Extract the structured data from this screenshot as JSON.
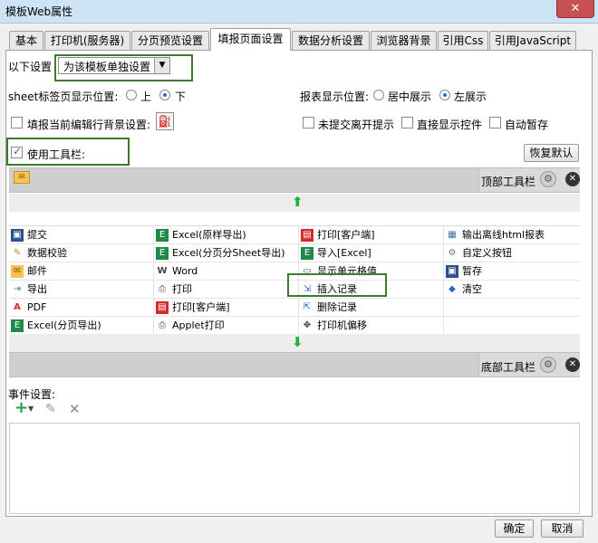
{
  "window": {
    "title": "模板Web属性",
    "close": "✕"
  },
  "tabs": [
    "基本",
    "打印机(服务器)",
    "分页预览设置",
    "填报页面设置",
    "数据分析设置",
    "浏览器背景",
    "引用Css",
    "引用JavaScript"
  ],
  "settings": {
    "below_label": "以下设置",
    "scope_value": "为该模板单独设置",
    "sheet_label": "sheet标签页显示位置:",
    "sheet_opt_top": "上",
    "sheet_opt_bottom": "下",
    "report_label": "报表显示位置:",
    "report_opt_center": "居中展示",
    "report_opt_left": "左展示",
    "fill_bg_label": "填报当前编辑行背景设置:",
    "unsubmitted_label": "未提交离开提示",
    "direct_show_label": "直接显示控件",
    "autosave_label": "自动暂存",
    "use_toolbar_label": "使用工具栏:",
    "restore_default": "恢复默认",
    "top_toolbar": "顶部工具栏",
    "bottom_toolbar": "底部工具栏",
    "event_label": "事件设置:"
  },
  "toolbar_items": [
    [
      "提交",
      "Excel(原样导出)",
      "打印[客户端]",
      "输出离线html报表"
    ],
    [
      "数据校验",
      "Excel(分页分Sheet导出)",
      "导入[Excel]",
      "自定义按钮"
    ],
    [
      "邮件",
      "Word",
      "显示单元格值",
      "暂存"
    ],
    [
      "导出",
      "打印",
      "插入记录",
      "清空"
    ],
    [
      "PDF",
      "打印[客户端]",
      "删除记录",
      ""
    ],
    [
      "Excel(分页导出)",
      "Applet打印",
      "打印机偏移",
      ""
    ]
  ],
  "footer": {
    "ok": "确定",
    "cancel": "取消"
  }
}
